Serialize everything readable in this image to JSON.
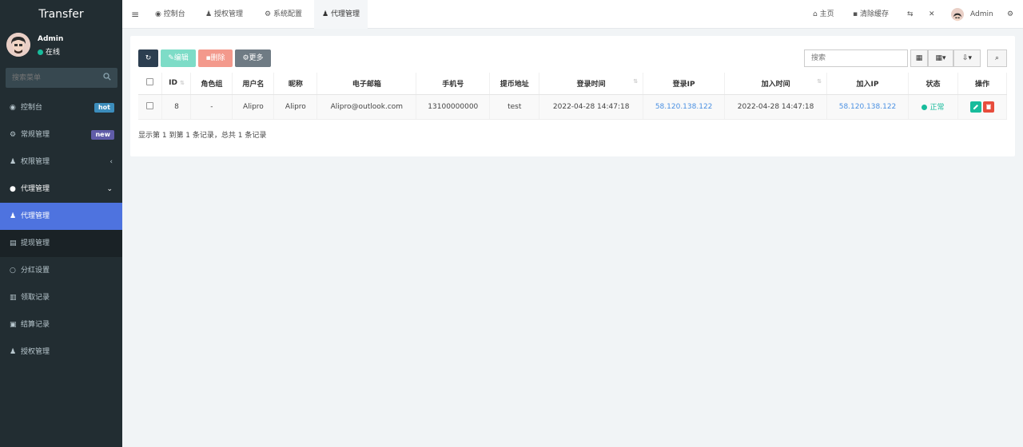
{
  "app": {
    "brand": "Transfer"
  },
  "user": {
    "name": "Admin",
    "status": "在线"
  },
  "sidebar": {
    "search_placeholder": "搜索菜单",
    "items": [
      {
        "label": "控制台",
        "badge": "hot"
      },
      {
        "label": "常规管理",
        "badge": "new"
      },
      {
        "label": "权限管理"
      },
      {
        "label": "代理管理"
      },
      {
        "label": "代理管理"
      },
      {
        "label": "提现管理"
      },
      {
        "label": "分红设置"
      },
      {
        "label": "领取记录"
      },
      {
        "label": "结算记录"
      },
      {
        "label": "授权管理"
      }
    ]
  },
  "topbar": {
    "tabs": [
      "控制台",
      "授权管理",
      "系统配置",
      "代理管理"
    ],
    "home": "主页",
    "clear_cache": "清除缓存",
    "admin": "Admin"
  },
  "toolbar": {
    "edit": "编辑",
    "delete": "删除",
    "more": "更多",
    "search_placeholder": "搜索"
  },
  "table": {
    "headers": [
      "ID",
      "角色组",
      "用户名",
      "昵称",
      "电子邮箱",
      "手机号",
      "提币地址",
      "登录时间",
      "登录IP",
      "加入时间",
      "加入IP",
      "状态",
      "操作"
    ],
    "rows": [
      {
        "id": "8",
        "role": "-",
        "username": "Alipro",
        "nickname": "Alipro",
        "email": "Alipro@outlook.com",
        "phone": "13100000000",
        "address": "test",
        "login_time": "2022-04-28 14:47:18",
        "login_ip": "58.120.138.122",
        "join_time": "2022-04-28 14:47:18",
        "join_ip": "58.120.138.122",
        "status": "正常"
      }
    ]
  },
  "pagination": {
    "summary": "显示第 1 到第 1 条记录，总共 1 条记录"
  }
}
